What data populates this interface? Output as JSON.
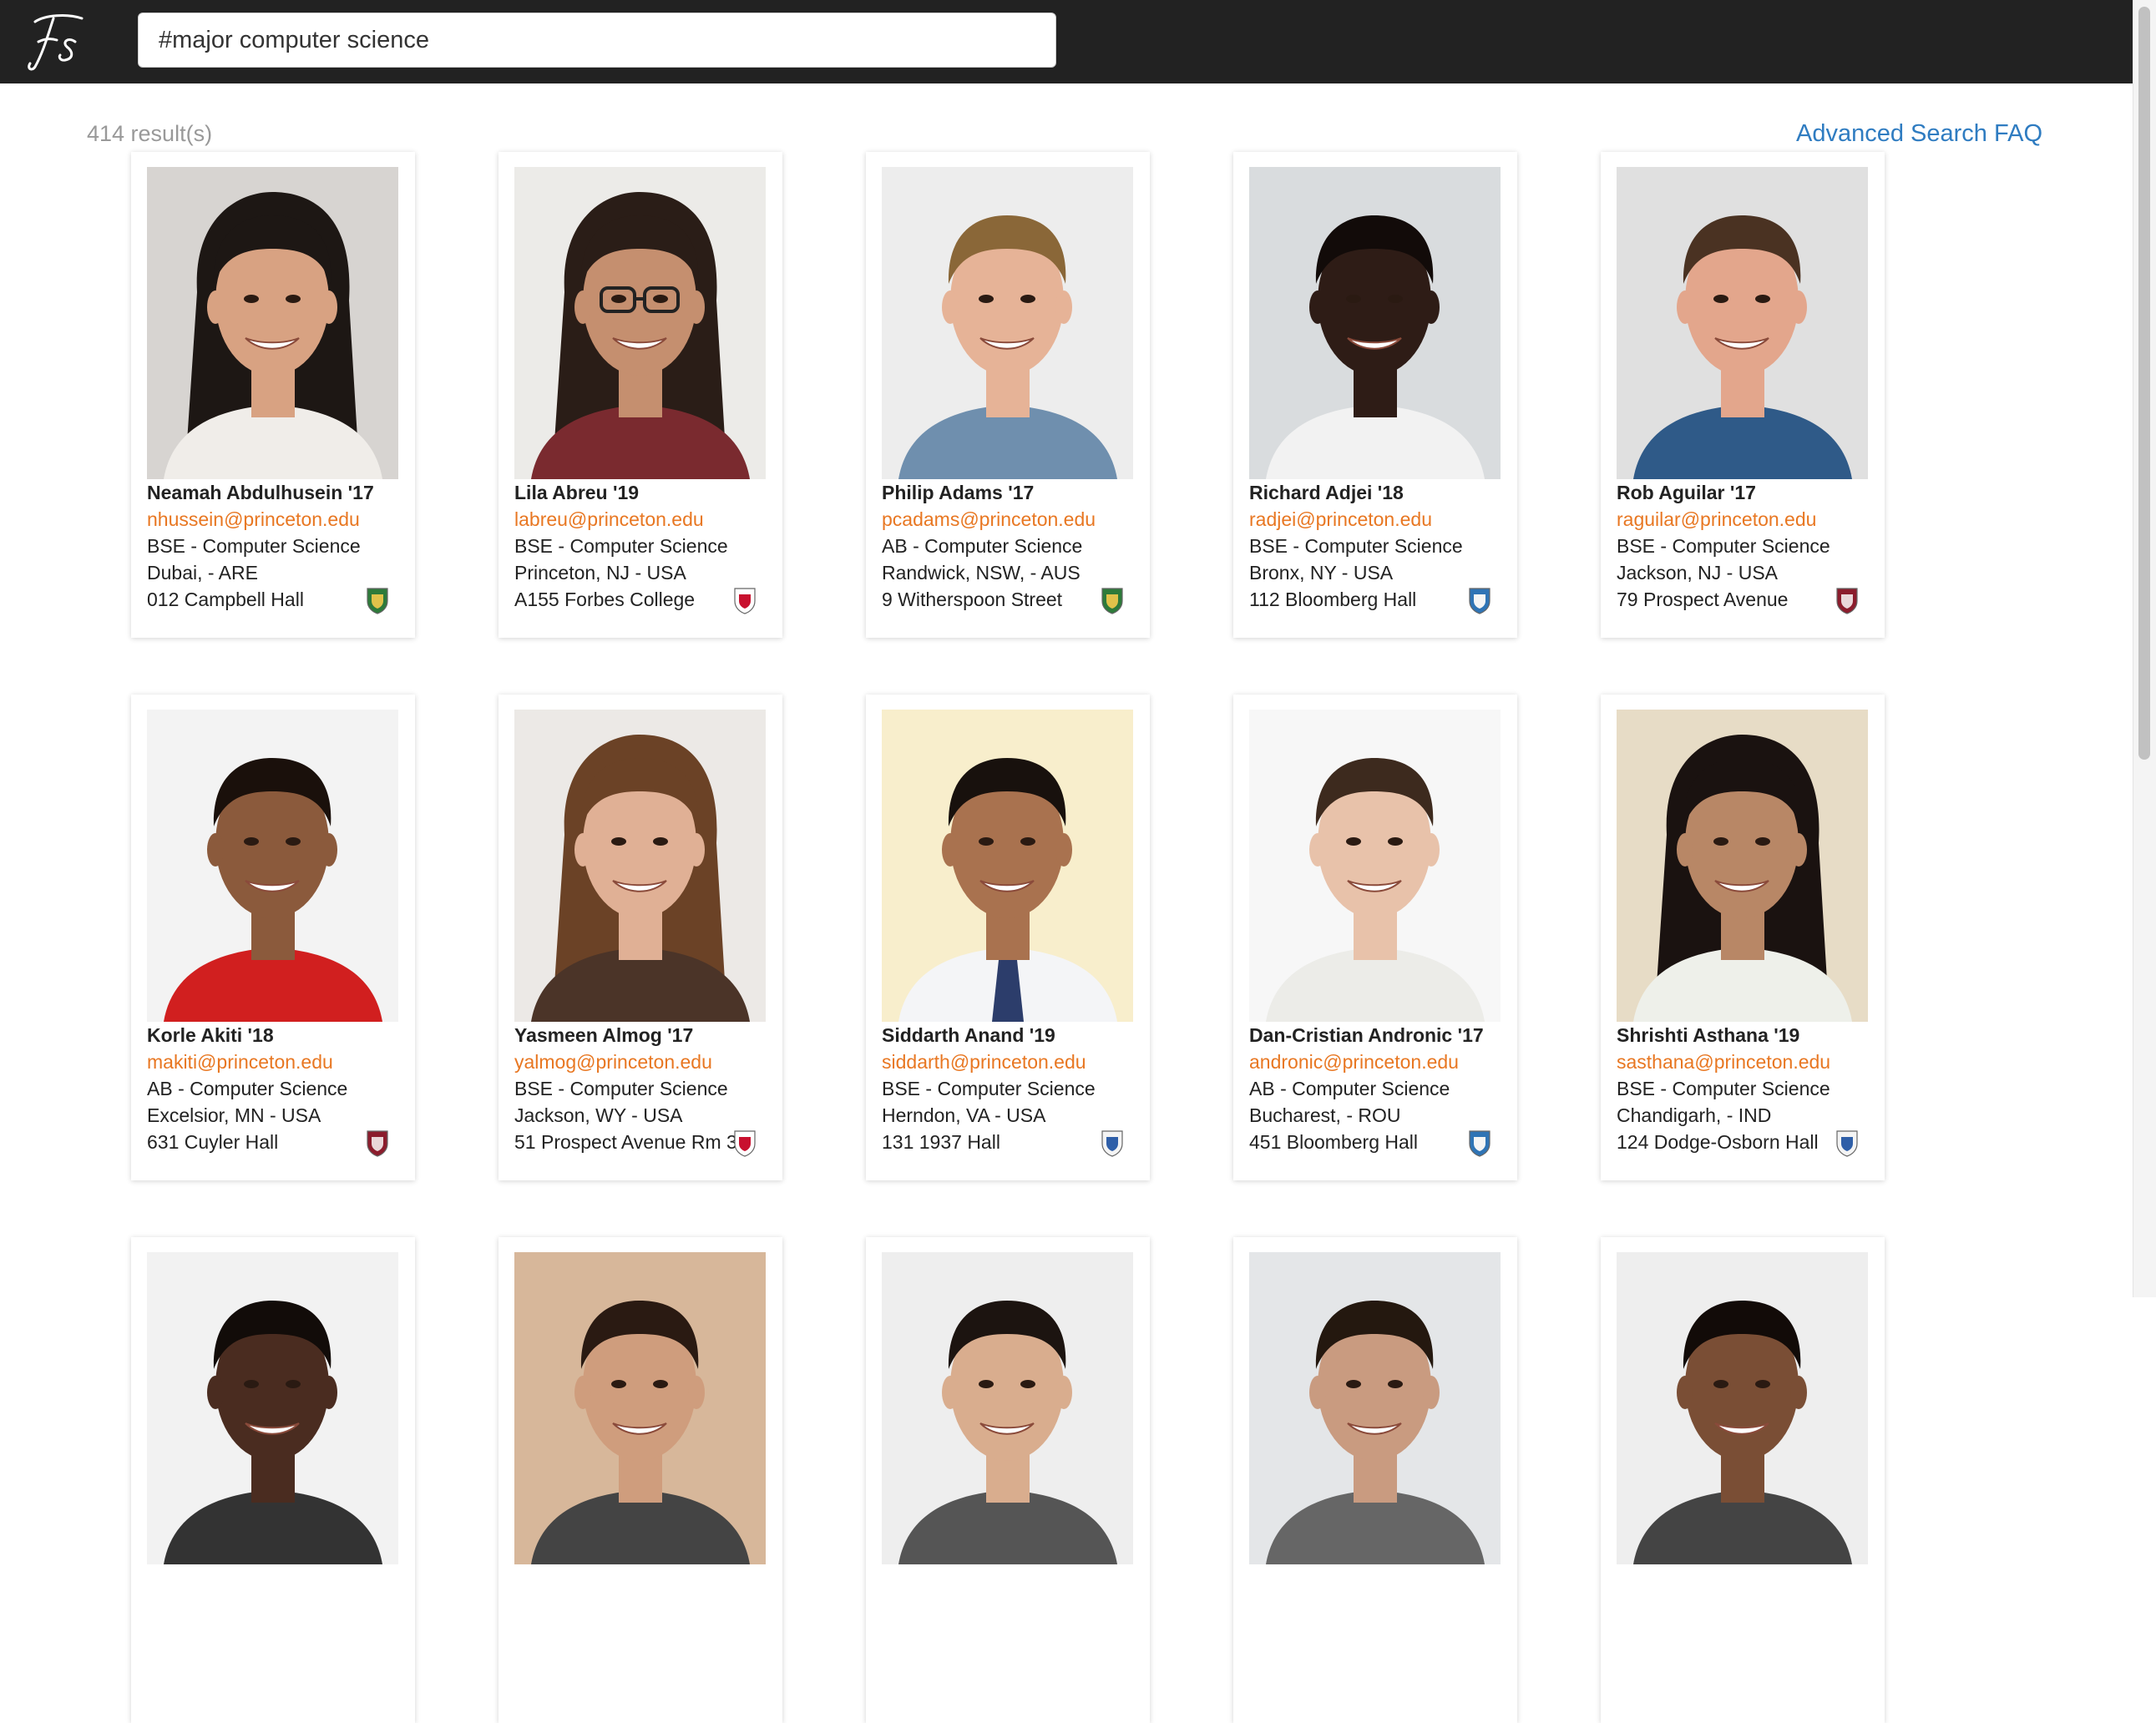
{
  "header": {
    "logo_text": "Fs",
    "search_value": "#major computer science"
  },
  "results": {
    "count_label": "414 result(s)",
    "faq_label": "Advanced Search FAQ"
  },
  "colors": {
    "topbar": "#222222",
    "email": "#e87722",
    "link": "#2f7cc1"
  },
  "students": [
    {
      "name": "Neamah Abdulhusein '17",
      "email": "nhussein@princeton.edu",
      "degree": "BSE - Computer Science",
      "hometown": "Dubai, - ARE",
      "room": "012 Campbell Hall",
      "college_icon": "green-crest-icon",
      "photo": {
        "bg": "#d7d4d1",
        "skin": "#d8a282",
        "hair": "#1d1714",
        "shirt": "#f0ede9",
        "long_hair": true
      }
    },
    {
      "name": "Lila Abreu '19",
      "email": "labreu@princeton.edu",
      "degree": "BSE - Computer Science",
      "hometown": "Princeton, NJ - USA",
      "room": "A155 Forbes College",
      "college_icon": "red-white-crest-icon",
      "photo": {
        "bg": "#ecebe8",
        "skin": "#c58f6f",
        "hair": "#2a1d17",
        "shirt": "#7a2a2f",
        "long_hair": true,
        "glasses": true
      }
    },
    {
      "name": "Philip Adams '17",
      "email": "pcadams@princeton.edu",
      "degree": "AB - Computer Science",
      "hometown": "Randwick, NSW, - AUS",
      "room": "9 Witherspoon Street",
      "college_icon": "green-crest-icon",
      "photo": {
        "bg": "#ededed",
        "skin": "#e6b397",
        "hair": "#8a6738",
        "shirt": "#6f8fae",
        "long_hair": false
      }
    },
    {
      "name": "Richard Adjei '18",
      "email": "radjei@princeton.edu",
      "degree": "BSE - Computer Science",
      "hometown": "Bronx, NY - USA",
      "room": "112 Bloomberg Hall",
      "college_icon": "blue-crest-icon",
      "photo": {
        "bg": "#d9dcde",
        "skin": "#2e1c16",
        "hair": "#120b09",
        "shirt": "#f2f2f2",
        "long_hair": false
      }
    },
    {
      "name": "Rob Aguilar '17",
      "email": "raguilar@princeton.edu",
      "degree": "BSE - Computer Science",
      "hometown": "Jackson, NJ - USA",
      "room": "79 Prospect Avenue",
      "college_icon": "maroon-crest-icon",
      "photo": {
        "bg": "#e0e0e0",
        "skin": "#e3a68c",
        "hair": "#4a3222",
        "shirt": "#2f5a88",
        "long_hair": false
      }
    },
    {
      "name": "Korle Akiti '18",
      "email": "makiti@princeton.edu",
      "degree": "AB - Computer Science",
      "hometown": "Excelsior, MN - USA",
      "room": "631 Cuyler Hall",
      "college_icon": "maroon-crest-icon",
      "photo": {
        "bg": "#f3f3f3",
        "skin": "#8b5a3c",
        "hair": "#1a100b",
        "shirt": "#d11f1f",
        "long_hair": false
      }
    },
    {
      "name": "Yasmeen Almog '17",
      "email": "yalmog@princeton.edu",
      "degree": "BSE - Computer Science",
      "hometown": "Jackson, WY - USA",
      "room": "51 Prospect Avenue Rm 3",
      "college_icon": "red-white-crest-icon",
      "photo": {
        "bg": "#ece9e6",
        "skin": "#e0b095",
        "hair": "#6b4226",
        "shirt": "#4b3428",
        "long_hair": true
      }
    },
    {
      "name": "Siddarth Anand '19",
      "email": "siddarth@princeton.edu",
      "degree": "BSE - Computer Science",
      "hometown": "Herndon, VA - USA",
      "room": "131 1937 Hall",
      "college_icon": "blue-gold-crest-icon",
      "photo": {
        "bg": "#f8eecc",
        "skin": "#a9724f",
        "hair": "#18110d",
        "shirt": "#f4f5f7",
        "long_hair": false,
        "tie": true
      }
    },
    {
      "name": "Dan-Cristian Andronic '17",
      "email": "andronic@princeton.edu",
      "degree": "AB - Computer Science",
      "hometown": "Bucharest, - ROU",
      "room": "451 Bloomberg Hall",
      "college_icon": "blue-crest-icon",
      "photo": {
        "bg": "#f7f7f7",
        "skin": "#e8c2aa",
        "hair": "#3d2a1e",
        "shirt": "#ecece8",
        "long_hair": false
      }
    },
    {
      "name": "Shrishti Asthana '19",
      "email": "sasthana@princeton.edu",
      "degree": "BSE - Computer Science",
      "hometown": "Chandigarh, - IND",
      "room": "124 Dodge-Osborn Hall",
      "college_icon": "blue-gold-crest-icon",
      "photo": {
        "bg": "#e7dcc6",
        "skin": "#b88766",
        "hair": "#1a1210",
        "shirt": "#eef0ea",
        "long_hair": true
      }
    },
    {
      "photo": {
        "bg": "#f2f2f2",
        "skin": "#4a2c20",
        "hair": "#120c09",
        "shirt": "#333",
        "long_hair": false
      }
    },
    {
      "photo": {
        "bg": "#d7b79a",
        "skin": "#cf9d7d",
        "hair": "#2a1a12",
        "shirt": "#444",
        "long_hair": false
      }
    },
    {
      "photo": {
        "bg": "#eeeeee",
        "skin": "#d9ad8e",
        "hair": "#1c1410",
        "shirt": "#555",
        "long_hair": false
      }
    },
    {
      "photo": {
        "bg": "#e4e6e8",
        "skin": "#c99b80",
        "hair": "#24180f",
        "shirt": "#666",
        "long_hair": false
      }
    },
    {
      "photo": {
        "bg": "#eeeeee",
        "skin": "#7a4e35",
        "hair": "#120b08",
        "shirt": "#444",
        "long_hair": false
      }
    }
  ]
}
